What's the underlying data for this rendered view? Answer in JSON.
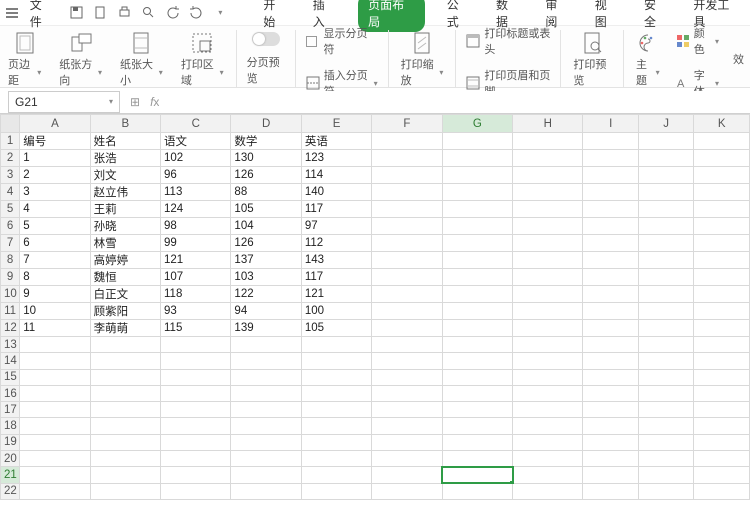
{
  "topbar": {
    "file_label": "文件",
    "tabs": [
      "开始",
      "插入",
      "页面布局",
      "公式",
      "数据",
      "审阅",
      "视图",
      "安全",
      "开发工具"
    ],
    "active_tab_index": 2
  },
  "ribbon": {
    "page_margin": "页边距",
    "orientation": "纸张方向",
    "size": "纸张大小",
    "print_area": "打印区域",
    "page_break_preview": "分页预览",
    "show_page_break": "显示分页符",
    "insert_page_break": "插入分页符",
    "print_scale": "打印缩放",
    "print_titles": "打印标题或表头",
    "header_footer": "打印页眉和页脚",
    "print_preview": "打印预览",
    "theme": "主题",
    "color": "颜色",
    "font": "字体",
    "effect": "效"
  },
  "namebox": {
    "cell": "G21"
  },
  "sheet": {
    "columns": [
      "A",
      "B",
      "C",
      "D",
      "E",
      "F",
      "G",
      "H",
      "I",
      "J",
      "K"
    ],
    "headers": {
      "A": "编号",
      "B": "姓名",
      "C": "语文",
      "D": "数学",
      "E": "英语"
    },
    "rows": [
      {
        "n": 1,
        "A": 1,
        "B": "张浩",
        "C": 102,
        "D": 130,
        "E": 123
      },
      {
        "n": 2,
        "A": 2,
        "B": "刘文",
        "C": 96,
        "D": 126,
        "E": 114
      },
      {
        "n": 3,
        "A": 3,
        "B": "赵立伟",
        "C": 113,
        "D": 88,
        "E": 140
      },
      {
        "n": 4,
        "A": 4,
        "B": "王莉",
        "C": 124,
        "D": 105,
        "E": 117
      },
      {
        "n": 5,
        "A": 5,
        "B": "孙晓",
        "C": 98,
        "D": 104,
        "E": 97
      },
      {
        "n": 6,
        "A": 6,
        "B": "林雪",
        "C": 99,
        "D": 126,
        "E": 112
      },
      {
        "n": 7,
        "A": 7,
        "B": "高婷婷",
        "C": 121,
        "D": 137,
        "E": 143
      },
      {
        "n": 8,
        "A": 8,
        "B": "魏恒",
        "C": 107,
        "D": 103,
        "E": 117
      },
      {
        "n": 9,
        "A": 9,
        "B": "白正文",
        "C": 118,
        "D": 122,
        "E": 121
      },
      {
        "n": 10,
        "A": 10,
        "B": "顾紫阳",
        "C": 93,
        "D": 94,
        "E": 100
      },
      {
        "n": 11,
        "A": 11,
        "B": "李萌萌",
        "C": 115,
        "D": 139,
        "E": 105
      }
    ],
    "selected": {
      "col": "G",
      "row": 21
    },
    "visible_rows": 22
  }
}
